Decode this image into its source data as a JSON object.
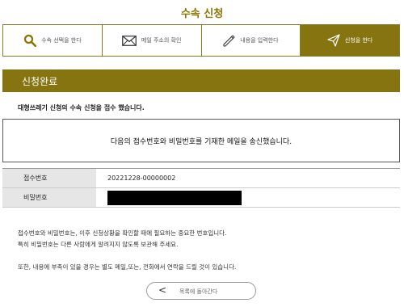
{
  "page_title": "수속 신청",
  "steps": [
    {
      "label": "수속 선택을 한다",
      "icon": "search-icon",
      "active": false
    },
    {
      "label": "메일 주소의 확인",
      "icon": "envelope-icon",
      "active": false
    },
    {
      "label": "내용을 입력한다",
      "icon": "pencil-icon",
      "active": false
    },
    {
      "label": "신청을 한다",
      "icon": "paper-plane-icon",
      "active": true
    }
  ],
  "section_title": "신청완료",
  "notice": "대형쓰레기 신청의 수속 신청을 접수 했습니다.",
  "message": "다음의 접수번호와 비밀번호를 기재한 메일을 송신했습니다.",
  "info": {
    "receipt_label": "접수번호",
    "receipt_value": "20221228-00000002",
    "password_label": "비밀번호"
  },
  "description": [
    "접수번호와 비밀번호는, 이후 신청상황을 확인할 때에 필요하는 중요한 번호입니다.",
    "특히 비밀번호는 다른 사람에게 알려지지 않도록 보관해 주세요.",
    "또한, 내용에 부족이 있을 경우는 별도 메일,또는, 전화에서 연락을 드릴 것이 있습니다."
  ],
  "back_button": {
    "chevron": "<",
    "label": "목록에 돌아간다"
  },
  "colors": {
    "accent": "#85740f",
    "title": "#8a7400"
  }
}
